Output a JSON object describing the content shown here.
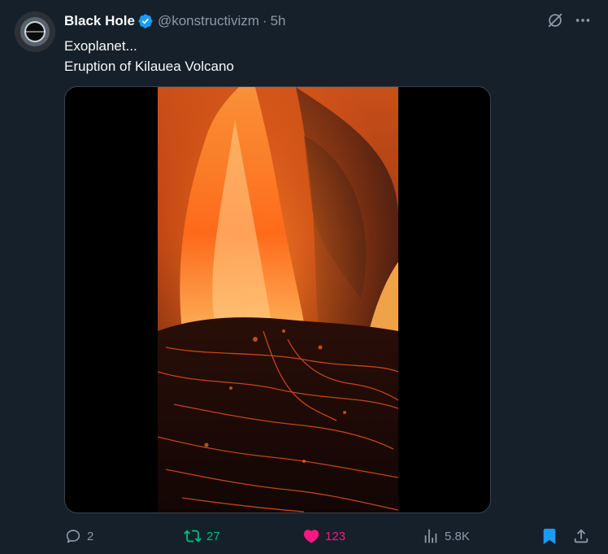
{
  "author": {
    "name": "Black Hole",
    "handle": "@konstructivizm",
    "separator": "·",
    "time": "5h",
    "verified": true,
    "avatar_icon": "black-hole-avatar"
  },
  "text": {
    "line1": "Exoplanet...",
    "line2": "Eruption of Kilauea Volcano"
  },
  "media": {
    "type": "video",
    "description_icon": "lava-eruption-frame"
  },
  "actions": {
    "replies": "2",
    "retweets": "27",
    "likes": "123",
    "views": "5.8K",
    "retweeted": true,
    "liked": true,
    "bookmarked": true
  },
  "colors": {
    "background": "#15202b",
    "text": "#f7f9f9",
    "secondary": "#8b98a5",
    "accent": "#1d9bf0",
    "retweet": "#00ba7c",
    "like": "#f91880"
  }
}
